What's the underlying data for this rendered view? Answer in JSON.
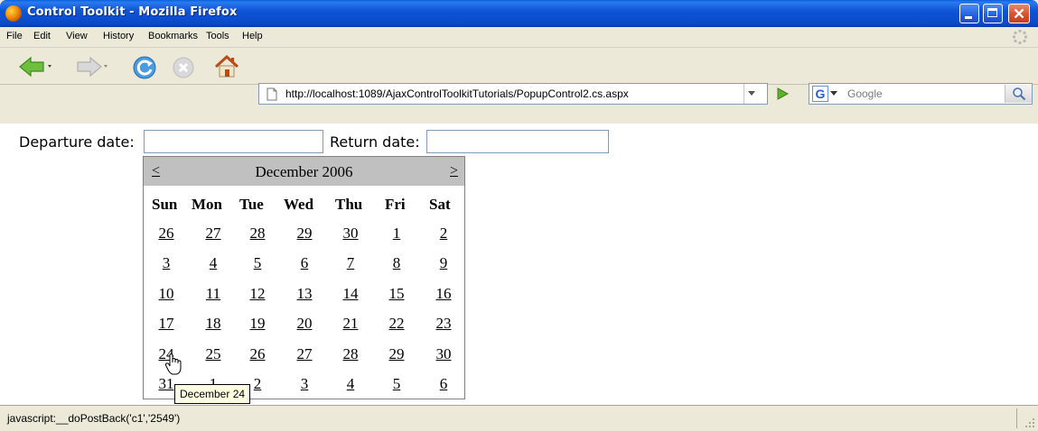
{
  "window": {
    "title": "Control Toolkit - Mozilla Firefox"
  },
  "menu": [
    "File",
    "Edit",
    "View",
    "History",
    "Bookmarks",
    "Tools",
    "Help"
  ],
  "navigation": {
    "back": "back-icon",
    "forward": "forward-icon",
    "reload": "reload-icon",
    "stop": "stop-icon",
    "home": "home-icon"
  },
  "address_bar": {
    "url": "http://localhost:1089/AjaxControlToolkitTutorials/PopupControl2.cs.aspx"
  },
  "search_bar": {
    "engine": "google-icon",
    "placeholder": "Google"
  },
  "form": {
    "departure_label": "Departure date:",
    "return_label": "Return date:",
    "departure_value": "",
    "return_value": ""
  },
  "calendar": {
    "prev": "<",
    "next": ">",
    "month": "December 2006",
    "days_of_week": [
      "Sun",
      "Mon",
      "Tue",
      "Wed",
      "Thu",
      "Fri",
      "Sat"
    ],
    "weeks": [
      [
        "26",
        "27",
        "28",
        "29",
        "30",
        "1",
        "2"
      ],
      [
        "3",
        "4",
        "5",
        "6",
        "7",
        "8",
        "9"
      ],
      [
        "10",
        "11",
        "12",
        "13",
        "14",
        "15",
        "16"
      ],
      [
        "17",
        "18",
        "19",
        "20",
        "21",
        "22",
        "23"
      ],
      [
        "24",
        "25",
        "26",
        "27",
        "28",
        "29",
        "30"
      ],
      [
        "31",
        "1",
        "2",
        "3",
        "4",
        "5",
        "6"
      ]
    ]
  },
  "tooltip": "December 24",
  "status_bar": {
    "text": "javascript:__doPostBack('c1','2549')"
  },
  "colors": {
    "titlebar": "#0a4ac9",
    "chrome": "#ece9d8",
    "calendar_header": "#c0c0c0",
    "tooltip_bg": "#ffffe1",
    "input_border": "#7f9db9"
  }
}
